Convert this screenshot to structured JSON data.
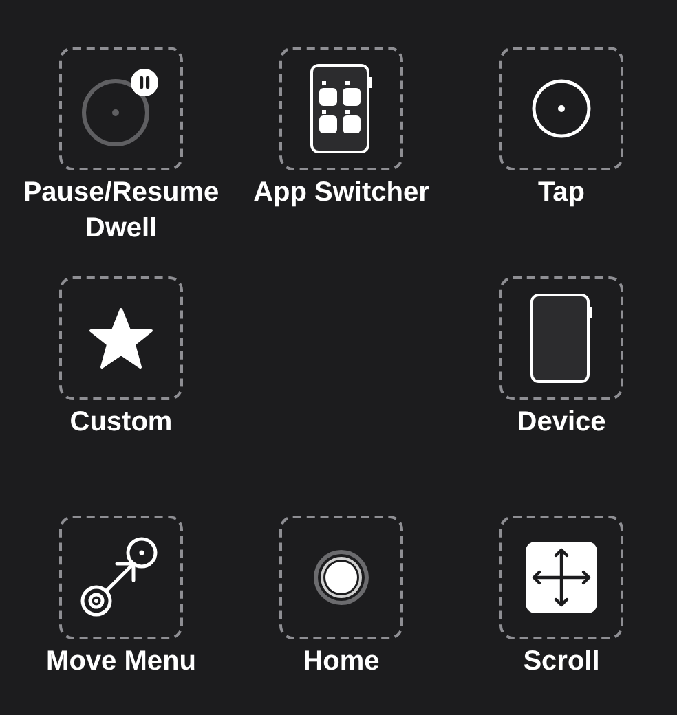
{
  "rows": [
    {
      "slots": [
        {
          "kind": "dwell",
          "label": "Pause/Resume Dwell"
        },
        {
          "kind": "app-switcher",
          "label": "App Switcher"
        },
        {
          "kind": "tap",
          "label": "Tap"
        }
      ]
    },
    {
      "slots": [
        {
          "kind": "custom",
          "label": "Custom"
        },
        {
          "kind": "empty"
        },
        {
          "kind": "device",
          "label": "Device"
        }
      ]
    },
    {
      "slots": [
        {
          "kind": "move-menu",
          "label": "Move Menu"
        },
        {
          "kind": "home",
          "label": "Home"
        },
        {
          "kind": "scroll",
          "label": "Scroll"
        }
      ]
    }
  ]
}
